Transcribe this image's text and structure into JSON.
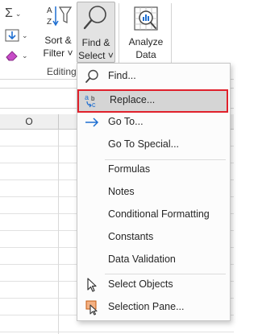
{
  "ribbon": {
    "sort_filter": {
      "line1": "Sort &",
      "line2": "Filter ˅"
    },
    "find_select": {
      "line1": "Find &",
      "line2": "Select ˅"
    },
    "analyze": {
      "line1": "Analyze",
      "line2": "Data"
    },
    "group_label": "Editing"
  },
  "sheet": {
    "column_header": "O"
  },
  "menu": {
    "items": [
      {
        "label": "Find...",
        "icon": "search-icon"
      },
      {
        "label": "Replace...",
        "icon": "replace-icon",
        "highlighted": true
      },
      {
        "label": "Go To...",
        "icon": "arrow-right-icon"
      },
      {
        "label": "Go To Special..."
      },
      {
        "label": "Formulas"
      },
      {
        "label": "Notes"
      },
      {
        "label": "Conditional Formatting"
      },
      {
        "label": "Constants"
      },
      {
        "label": "Data Validation"
      },
      {
        "label": "Select Objects",
        "icon": "cursor-icon"
      },
      {
        "label": "Selection Pane...",
        "icon": "selection-pane-icon"
      }
    ]
  },
  "colors": {
    "highlight_border": "#e0202b",
    "accent_blue": "#1f6fd1"
  }
}
